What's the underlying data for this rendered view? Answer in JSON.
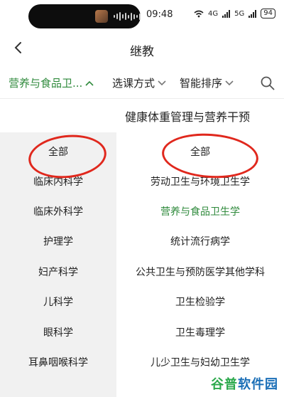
{
  "status": {
    "time": "09:48",
    "signal_1": "4G",
    "signal_2": "5G",
    "battery": "94"
  },
  "nav": {
    "title": "继教"
  },
  "filters": [
    {
      "label": "营养与食品卫...",
      "active": true
    },
    {
      "label": "选课方式",
      "active": false
    },
    {
      "label": "智能排序",
      "active": false
    }
  ],
  "panel": {
    "title": "健康体重管理与营养干预"
  },
  "left_items": [
    "全部",
    "临床内科学",
    "临床外科学",
    "护理学",
    "妇产科学",
    "儿科学",
    "眼科学",
    "耳鼻咽喉科学"
  ],
  "right_items": [
    "全部",
    "劳动卫生与环境卫生学",
    "营养与食品卫生学",
    "统计流行病学",
    "公共卫生与预防医学其他学科",
    "卫生检验学",
    "卫生毒理学",
    "儿少卫生与妇幼卫生学"
  ],
  "selected_right": "营养与食品卫生学",
  "watermark": {
    "part1": "谷普",
    "part2": "软件园"
  },
  "colors": {
    "accent": "#2f8a3c",
    "annotation": "#e0281d",
    "left_bg": "#f1f1f1"
  }
}
